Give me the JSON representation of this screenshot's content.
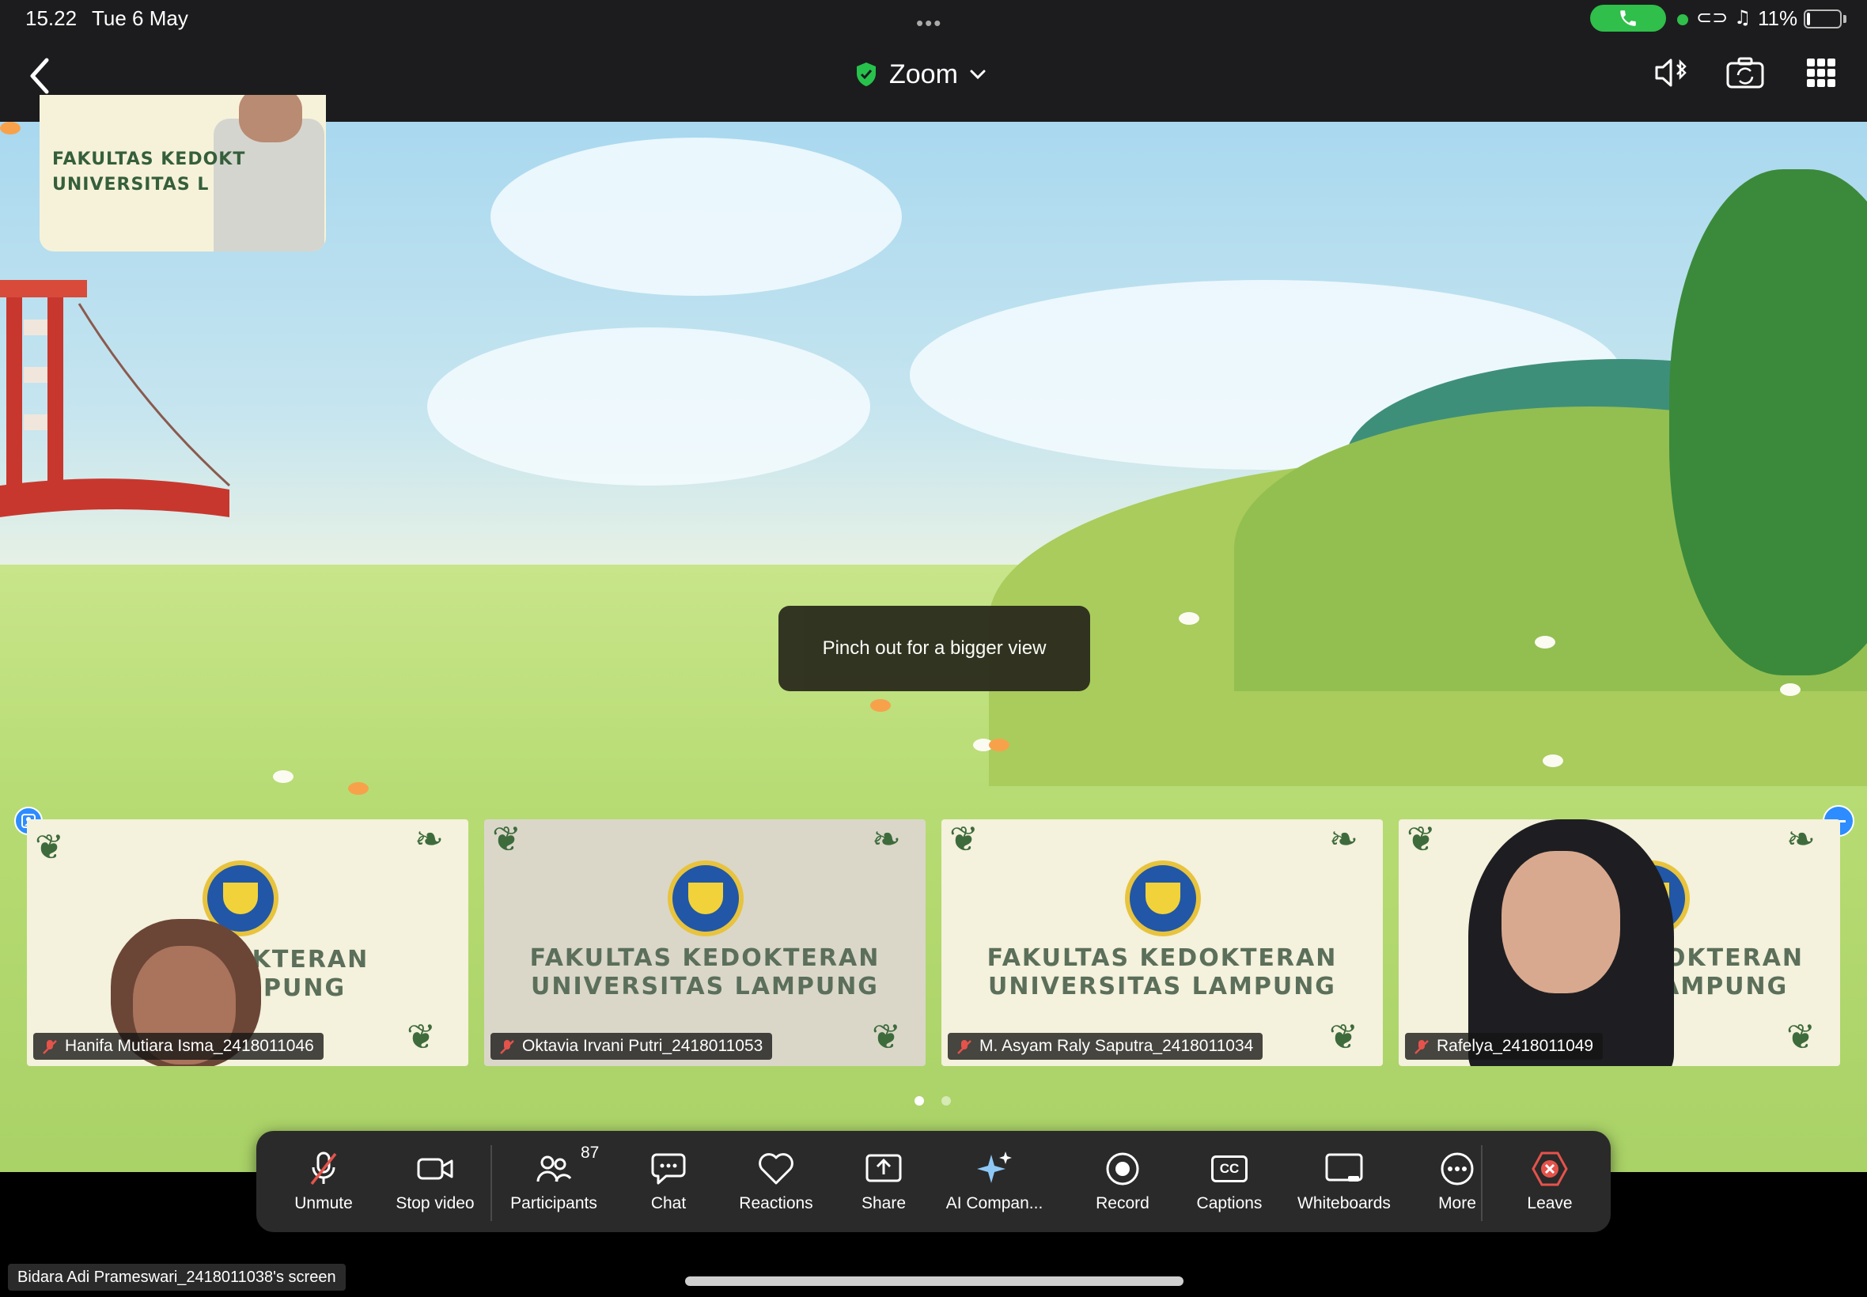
{
  "status_bar": {
    "time": "15.22",
    "date": "Tue 6 May",
    "dots": "•••",
    "battery_percent": "11%",
    "battery_level": 0.11,
    "call_active_color": "#2fbf4a"
  },
  "header": {
    "title": "Zoom",
    "back_icon": "chevron-left-icon",
    "shield_icon": "shield-check-icon",
    "chevron_icon": "chevron-down-icon",
    "speaker_icon": "speaker-bluetooth-icon",
    "camera_icon": "camera-switch-icon",
    "grid_icon": "grid-view-icon"
  },
  "shared_screen": {
    "toast": "Pinch out for a bigger view",
    "speaker_thumb_text": [
      "FAKULTAS KEDOKT",
      "UNIVERSITAS L"
    ]
  },
  "gallery": {
    "tiles": [
      {
        "name": "Hanifa Mutiara Isma_2418011046",
        "text_line1": "FAK          EDOKTERAN",
        "text_line2": "UN            LAMPUNG",
        "has_face": true
      },
      {
        "name": "Oktavia Irvani Putri_2418011053",
        "text_line1": "FAKULTAS KEDOKTERAN",
        "text_line2": "UNIVERSITAS LAMPUNG",
        "has_face": false
      },
      {
        "name": "M. Asyam Raly Saputra_2418011034",
        "text_line1": "FAKULTAS KEDOKTERAN",
        "text_line2": "UNIVERSITAS LAMPUNG",
        "has_face": false
      },
      {
        "name": "Rafelya_2418011049",
        "text_line1": "DOKTERAN",
        "text_line2": "LAMPUNG",
        "has_face": true
      }
    ],
    "page_count": 2,
    "current_page": 1
  },
  "controls": {
    "unmute": "Unmute",
    "stop_video": "Stop video",
    "participants": "Participants",
    "participants_count": "87",
    "chat": "Chat",
    "reactions": "Reactions",
    "share": "Share",
    "ai_companion": "AI Compan...",
    "record": "Record",
    "captions": "Captions",
    "captions_glyph": "CC",
    "whiteboards": "Whiteboards",
    "more": "More",
    "leave": "Leave",
    "leave_color": "#e5534b"
  },
  "footer": {
    "screen_label": "Bidara Adi Prameswari_2418011038's screen"
  }
}
